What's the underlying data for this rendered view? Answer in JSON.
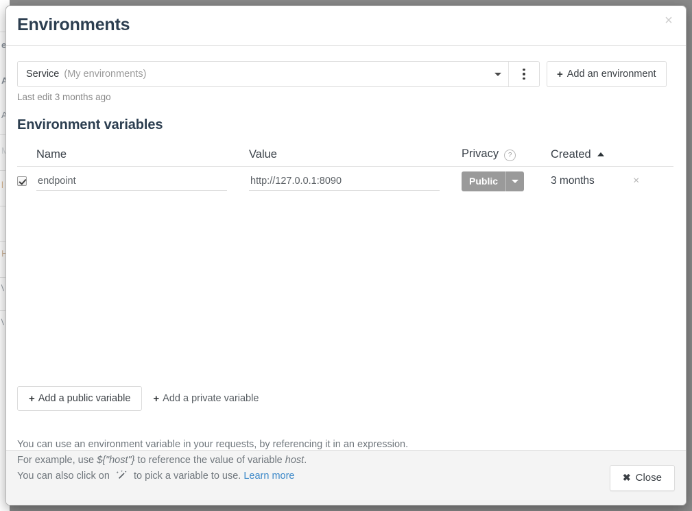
{
  "background_page": {
    "ghost_lines": [
      "e",
      "A",
      "A",
      "M",
      "l",
      "H",
      "/",
      "/"
    ]
  },
  "modal": {
    "title": "Environments",
    "close_icon": "close-icon",
    "environment_selector": {
      "name": "Service",
      "scope": "(My environments)",
      "caret_icon": "chevron-down-icon",
      "kebab_icon": "more-vertical-icon"
    },
    "add_environment_button": {
      "plus": "+",
      "label": "Add an environment"
    },
    "last_edit": "Last edit 3 months ago",
    "section_title": "Environment variables",
    "table": {
      "columns": {
        "name": "Name",
        "value": "Value",
        "privacy": "Privacy",
        "privacy_help_icon": "?",
        "created": "Created",
        "sort_direction": "asc"
      },
      "rows": [
        {
          "checked": true,
          "name": "endpoint",
          "value": "http://127.0.0.1:8090",
          "privacy": "Public",
          "privacy_caret_icon": "caret-down-icon",
          "created": "3 months",
          "delete_icon": "×"
        }
      ]
    },
    "add_public_variable_button": {
      "plus": "+",
      "label": "Add a public variable"
    },
    "add_private_variable_button": {
      "plus": "+",
      "label": "Add a private variable"
    },
    "help_text": {
      "line1": "You can use an environment variable in your requests, by referencing it in an expression.",
      "line2_prefix": "For example, use ",
      "line2_code": "${\"host\"}",
      "line2_mid": " to reference the value of variable ",
      "line2_var": "host",
      "line2_suffix": ".",
      "line3_prefix": "You can also click on ",
      "line3_icon": "magic-wand-icon",
      "line3_mid": " to pick a variable to use. ",
      "line3_link": "Learn more"
    },
    "footer": {
      "close_button": {
        "icon": "✖",
        "label": "Close"
      }
    }
  },
  "colors": {
    "title": "#2c3e50",
    "privacy_badge": "#9a9a9a",
    "link": "#3a87c8",
    "footer_bg": "#f4f4f4"
  }
}
